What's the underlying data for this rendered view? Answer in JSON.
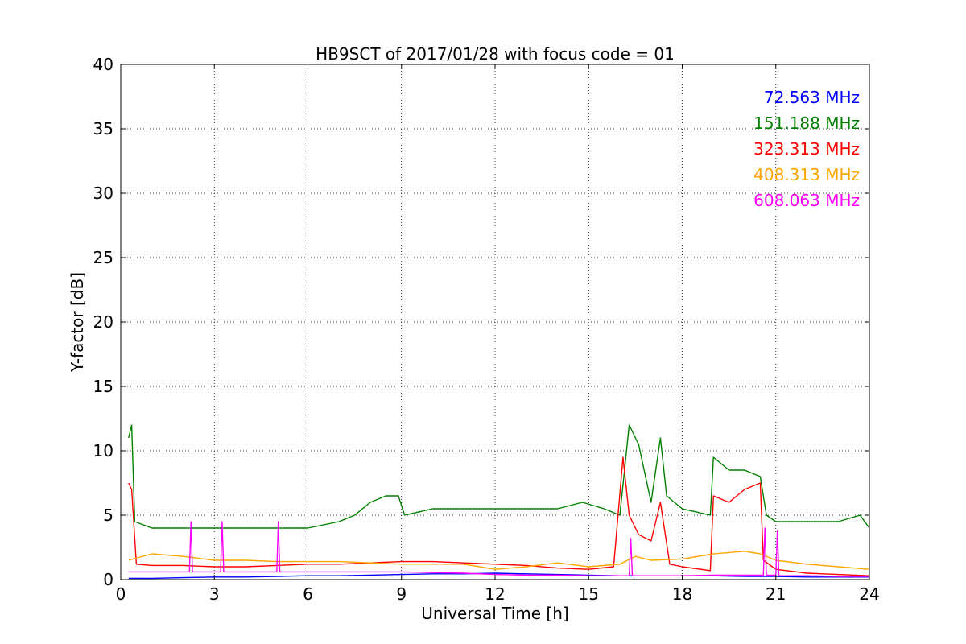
{
  "chart_data": {
    "type": "line",
    "title": "HB9SCT of 2017/01/28 with focus code = 01",
    "xlabel": "Universal Time [h]",
    "ylabel": "Y-factor [dB]",
    "xlim": [
      0,
      24
    ],
    "ylim": [
      0,
      40
    ],
    "xticks": [
      0,
      3,
      6,
      9,
      12,
      15,
      18,
      21,
      24
    ],
    "yticks": [
      0,
      5,
      10,
      15,
      20,
      25,
      30,
      35,
      40
    ],
    "grid": true,
    "legend_position": "top-right",
    "series": [
      {
        "name": "72.563 MHz",
        "color": "#0000ff",
        "x": [
          0.25,
          1,
          2,
          3,
          4,
          5,
          6,
          7,
          8,
          9,
          10,
          11,
          12,
          13,
          14,
          15,
          16,
          17,
          18,
          19,
          20,
          21,
          22,
          23,
          24
        ],
        "y": [
          0.1,
          0.1,
          0.15,
          0.2,
          0.2,
          0.25,
          0.3,
          0.3,
          0.35,
          0.4,
          0.45,
          0.45,
          0.5,
          0.45,
          0.4,
          0.35,
          0.3,
          0.3,
          0.3,
          0.3,
          0.25,
          0.25,
          0.2,
          0.2,
          0.2
        ]
      },
      {
        "name": "151.188 MHz",
        "color": "#008000",
        "x": [
          0.25,
          0.35,
          0.45,
          1,
          2,
          3,
          4,
          5,
          6,
          7,
          7.5,
          8,
          8.5,
          8.9,
          9.1,
          10,
          11,
          12,
          13,
          14,
          14.8,
          15.5,
          16,
          16.3,
          16.6,
          17,
          17.3,
          17.5,
          18,
          18.9,
          19,
          19.5,
          20,
          20.5,
          20.7,
          21,
          22,
          23,
          23.7,
          24
        ],
        "y": [
          11,
          12,
          4.5,
          4,
          4,
          4,
          4,
          4,
          4,
          4.5,
          5,
          6,
          6.5,
          6.5,
          5,
          5.5,
          5.5,
          5.5,
          5.5,
          5.5,
          6,
          5.5,
          5,
          12,
          10.5,
          6,
          11,
          6.5,
          5.5,
          5,
          9.5,
          8.5,
          8.5,
          8,
          5,
          4.5,
          4.5,
          4.5,
          5,
          4
        ]
      },
      {
        "name": "323.313 MHz",
        "color": "#ff0000",
        "x": [
          0.25,
          0.35,
          0.5,
          1,
          2,
          3,
          4,
          5,
          6,
          7,
          8,
          9,
          10,
          11,
          12,
          13,
          14,
          15,
          15.8,
          16.1,
          16.3,
          16.6,
          17,
          17.3,
          17.6,
          18,
          18.9,
          19,
          19.5,
          20,
          20.5,
          20.6,
          21,
          22,
          23,
          24
        ],
        "y": [
          7.5,
          7,
          1.2,
          1.1,
          1.1,
          1,
          1,
          1.1,
          1.2,
          1.2,
          1.3,
          1.4,
          1.4,
          1.3,
          1.2,
          1.1,
          0.9,
          0.8,
          1,
          9.5,
          5,
          3.5,
          3,
          6,
          1.2,
          1,
          0.7,
          6.5,
          6,
          7,
          7.5,
          1.5,
          0.8,
          0.5,
          0.4,
          0.3
        ]
      },
      {
        "name": "408.313 MHz",
        "color": "#ffa500",
        "x": [
          0.25,
          1,
          2,
          3,
          4,
          5,
          6,
          7,
          8,
          9,
          10,
          11,
          11.5,
          12,
          13,
          14,
          15,
          16,
          16.5,
          17,
          18,
          19,
          20,
          20.5,
          21,
          22,
          23,
          24
        ],
        "y": [
          1.5,
          2,
          1.8,
          1.5,
          1.5,
          1.4,
          1.4,
          1.4,
          1.3,
          1.2,
          1.2,
          1.2,
          1.0,
          0.8,
          1.0,
          1.3,
          1.0,
          1.2,
          1.8,
          1.5,
          1.6,
          2.0,
          2.2,
          2.0,
          1.5,
          1.2,
          1.0,
          0.8
        ]
      },
      {
        "name": "608.063 MHz",
        "color": "#ff00ff",
        "x": [
          0.25,
          1,
          2.2,
          2.25,
          2.3,
          3,
          3.2,
          3.25,
          3.3,
          4,
          5,
          5.05,
          5.1,
          6,
          7,
          8,
          9,
          10,
          11,
          12,
          13,
          14,
          15,
          16,
          16.3,
          16.35,
          16.4,
          17,
          18,
          19,
          20,
          20.6,
          20.65,
          20.7,
          21,
          21.05,
          21.1,
          22,
          23,
          24
        ],
        "y": [
          0.6,
          0.6,
          0.6,
          4.5,
          0.6,
          0.6,
          0.6,
          4.5,
          0.6,
          0.6,
          0.6,
          4.5,
          0.6,
          0.6,
          0.6,
          0.6,
          0.6,
          0.55,
          0.5,
          0.4,
          0.35,
          0.35,
          0.3,
          0.3,
          0.3,
          3.2,
          0.3,
          0.3,
          0.3,
          0.35,
          0.35,
          0.35,
          4.0,
          0.35,
          0.35,
          3.8,
          0.3,
          0.3,
          0.25,
          0.25
        ]
      }
    ]
  }
}
